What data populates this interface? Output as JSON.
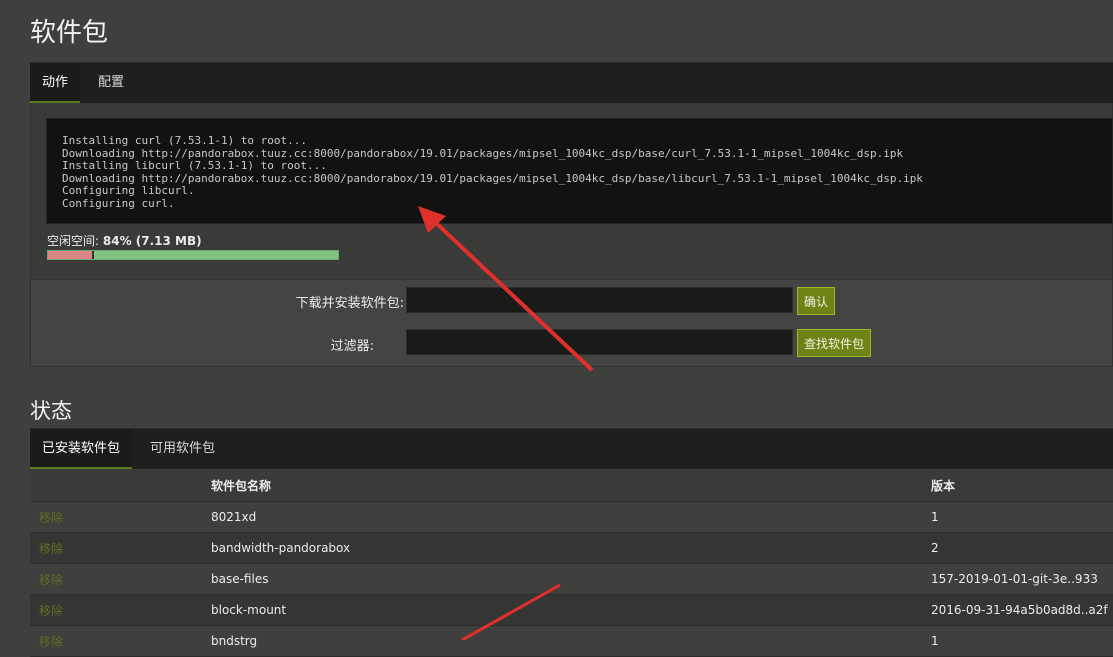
{
  "page": {
    "title": "软件包"
  },
  "action_tabs": [
    {
      "label": "动作"
    },
    {
      "label": "配置"
    }
  ],
  "console": {
    "lines": [
      "Installing curl (7.53.1-1) to root...",
      "Downloading http://pandorabox.tuuz.cc:8000/pandorabox/19.01/packages/mipsel_1004kc_dsp/base/curl_7.53.1-1_mipsel_1004kc_dsp.ipk",
      "Installing libcurl (7.53.1-1) to root...",
      "Downloading http://pandorabox.tuuz.cc:8000/pandorabox/19.01/packages/mipsel_1004kc_dsp/base/libcurl_7.53.1-1_mipsel_1004kc_dsp.ipk",
      "Configuring libcurl.",
      "Configuring curl."
    ]
  },
  "free_space": {
    "label": "空闲空间:",
    "value": "84% (7.13 MB)",
    "free_fraction": 0.84,
    "colors": {
      "used": "#d98686",
      "free": "#84c184"
    }
  },
  "install_form": {
    "download_label": "下载并安装软件包:",
    "download_value": "",
    "confirm_button": "确认",
    "filter_label": "过滤器:",
    "filter_value": "",
    "find_button": "查找软件包"
  },
  "status": {
    "title": "状态"
  },
  "status_tabs": [
    {
      "label": "已安装软件包"
    },
    {
      "label": "可用软件包"
    }
  ],
  "packages": {
    "headers": {
      "name": "软件包名称",
      "version": "版本"
    },
    "remove_label": "移除",
    "rows": [
      {
        "name": "8021xd",
        "version": "1"
      },
      {
        "name": "bandwidth-pandorabox",
        "version": "2"
      },
      {
        "name": "base-files",
        "version": "157-2019-01-01-git-3e..933"
      },
      {
        "name": "block-mount",
        "version": "2016-09-31-94a5b0ad8d..a2f"
      },
      {
        "name": "bndstrg",
        "version": "1"
      }
    ]
  },
  "colors": {
    "accent": "#6e8316",
    "annotation_arrow": "#e0302c"
  }
}
